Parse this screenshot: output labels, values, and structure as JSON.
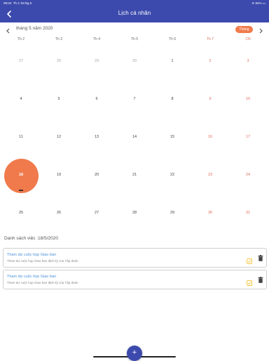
{
  "status_bar": {
    "time": "09:04",
    "date": "Th 2 18 thg 5",
    "battery": "84%"
  },
  "app_bar": {
    "title": "Lịch cá nhân"
  },
  "calendar": {
    "month_label": "tháng 5 năm 2020",
    "view_button": "Tháng",
    "weekdays": [
      "Th 2",
      "Th 3",
      "Th 4",
      "Th 5",
      "Th 6",
      "Th 7",
      "CN"
    ],
    "weeks": [
      [
        "27",
        "28",
        "29",
        "30",
        "1",
        "2",
        "3"
      ],
      [
        "4",
        "5",
        "6",
        "7",
        "8",
        "9",
        "10"
      ],
      [
        "11",
        "12",
        "13",
        "14",
        "15",
        "16",
        "17"
      ],
      [
        "18",
        "19",
        "20",
        "21",
        "22",
        "23",
        "24"
      ],
      [
        "25",
        "26",
        "27",
        "28",
        "29",
        "30",
        "31"
      ]
    ],
    "outside_first_week_count": 4,
    "selected_day": "18",
    "selected_color": "#f07a4c"
  },
  "task_list": {
    "title": "Danh sách việc :18/5/2020",
    "items": [
      {
        "title": "Tham dự cuộc họp Giao ban",
        "subtitle": "Tham dự cuộc họp Giao ban định kỳ của Tập đoàn"
      },
      {
        "title": "Tham dự cuộc họp Giao ban",
        "subtitle": "Tham dự cuộc họp Giao ban định kỳ của Tập đoàn"
      }
    ]
  },
  "fab": {
    "label": "+"
  },
  "colors": {
    "primary": "#3c4aad",
    "accent": "#f07a4c",
    "weekend": "#e06b5a",
    "link": "#4a90d9"
  }
}
